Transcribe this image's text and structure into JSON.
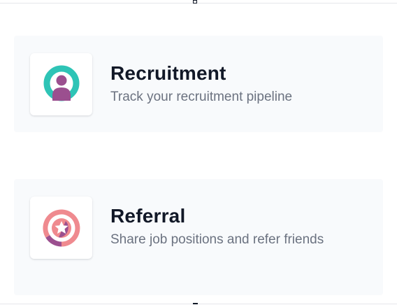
{
  "cards": [
    {
      "title": "Recruitment",
      "description": "Track your recruitment pipeline",
      "icon": "recruitment-logo-icon"
    },
    {
      "title": "Referral",
      "description": "Share job positions and refer friends",
      "icon": "referral-star-icon"
    }
  ],
  "colors": {
    "card_background": "#f8fafc",
    "title": "#111827",
    "description": "#6b7280",
    "recruitment_teal": "#2ec4b6",
    "recruitment_purple": "#9b4f8f",
    "referral_pink": "#ef8a8f",
    "referral_purple": "#9b4f8f"
  }
}
